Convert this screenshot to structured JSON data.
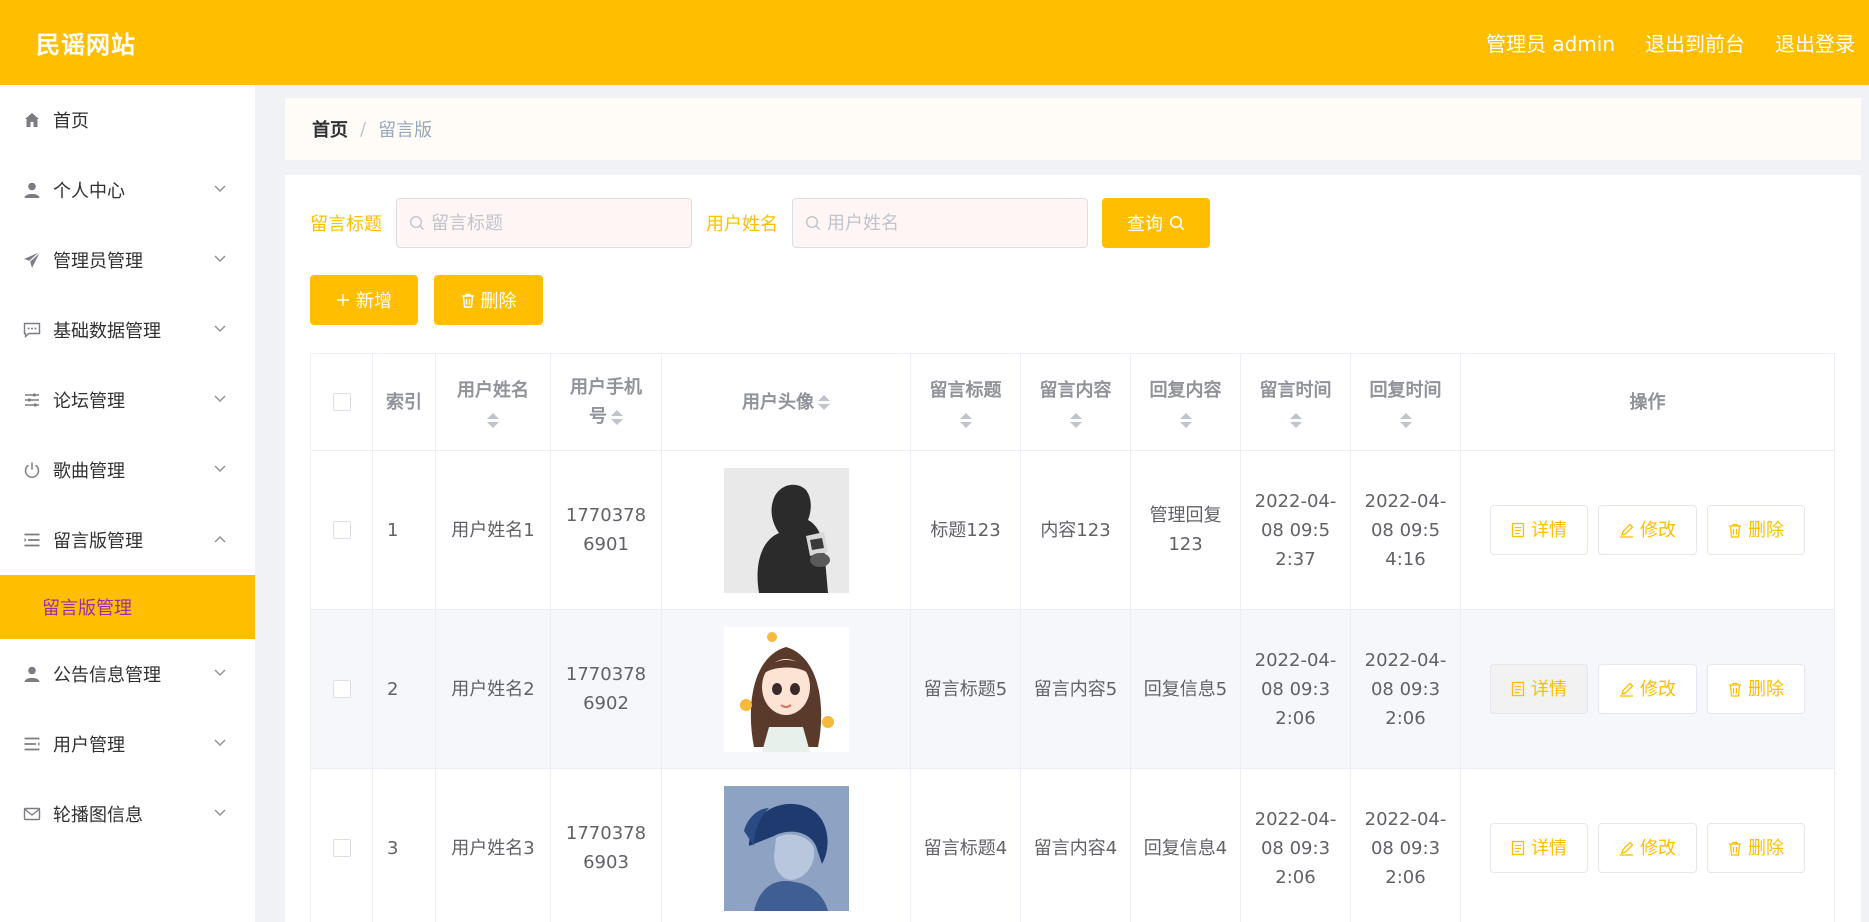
{
  "header": {
    "brand": "民谣网站",
    "admin_label": "管理员 admin",
    "to_front": "退出到前台",
    "logout": "退出登录"
  },
  "sidebar": {
    "items": [
      {
        "label": "首页",
        "icon": "home-icon"
      },
      {
        "label": "个人中心",
        "icon": "user-icon"
      },
      {
        "label": "管理员管理",
        "icon": "send-icon"
      },
      {
        "label": "基础数据管理",
        "icon": "chat-icon"
      },
      {
        "label": "论坛管理",
        "icon": "sliders-icon"
      },
      {
        "label": "歌曲管理",
        "icon": "power-icon"
      },
      {
        "label": "留言版管理",
        "icon": "list-icon"
      },
      {
        "label": "公告信息管理",
        "icon": "user-icon"
      },
      {
        "label": "用户管理",
        "icon": "list-icon"
      },
      {
        "label": "轮播图信息",
        "icon": "mail-icon"
      }
    ],
    "active_sub": "留言版管理"
  },
  "breadcrumb": {
    "home": "首页",
    "separator": "/",
    "current": "留言版"
  },
  "search": {
    "title_label": "留言标题",
    "title_placeholder": "留言标题",
    "user_label": "用户姓名",
    "user_placeholder": "用户姓名",
    "query_button": "查询"
  },
  "actions": {
    "add": "新增",
    "delete": "删除"
  },
  "table": {
    "headers": {
      "index": "索引",
      "user_name": "用户姓名",
      "user_phone": "用户手机号",
      "avatar": "用户头像",
      "title": "留言标题",
      "content": "留言内容",
      "reply": "回复内容",
      "msg_time": "留言时间",
      "reply_time": "回复时间",
      "ops": "操作"
    },
    "rows": [
      {
        "index": "1",
        "user_name": "用户姓名1",
        "phone": "17703786901",
        "title": "标题123",
        "content": "内容123",
        "reply": "管理回复123",
        "msg_time": "2022-04-08 09:52:37",
        "reply_time": "2022-04-08 09:54:16"
      },
      {
        "index": "2",
        "user_name": "用户姓名2",
        "phone": "17703786902",
        "title": "留言标题5",
        "content": "留言内容5",
        "reply": "回复信息5",
        "msg_time": "2022-04-08 09:32:06",
        "reply_time": "2022-04-08 09:32:06"
      },
      {
        "index": "3",
        "user_name": "用户姓名3",
        "phone": "17703786903",
        "title": "留言标题4",
        "content": "留言内容4",
        "reply": "回复信息4",
        "msg_time": "2022-04-08 09:32:06",
        "reply_time": "2022-04-08 09:32:06"
      }
    ],
    "op_labels": {
      "detail": "详情",
      "edit": "修改",
      "delete": "删除"
    }
  },
  "colors": {
    "accent": "#ffbf00",
    "active_sub_text": "#9b2fa8"
  }
}
